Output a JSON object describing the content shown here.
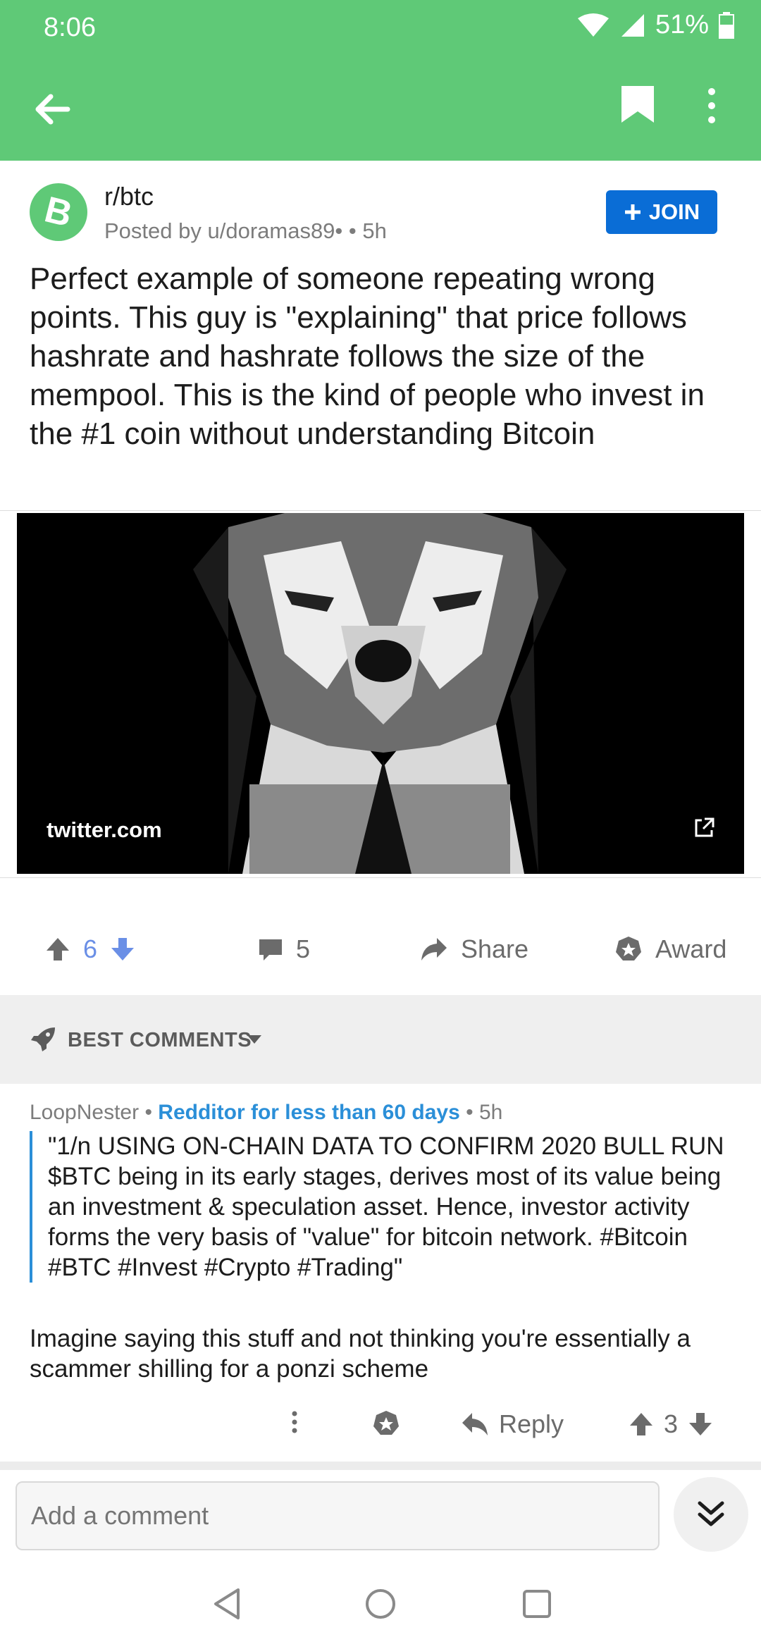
{
  "status": {
    "time": "8:06",
    "battery": "51%"
  },
  "post": {
    "subreddit": "r/btc",
    "subreddit_icon_letter": "B",
    "posted_by": "Posted by u/doramas89• • 5h",
    "join_label": "JOIN",
    "title": "Perfect example of someone repeating wrong points. This guy is \"explaining\" that price follows hashrate and hashrate follows the size of the mempool. This is the kind of people who invest in the #1 coin without understanding Bitcoin",
    "link_domain": "twitter.com",
    "score": "6",
    "comments_count": "5",
    "share_label": "Share",
    "award_label": "Award"
  },
  "sort": {
    "label": "BEST COMMENTS"
  },
  "comment": {
    "author": "LoopNester",
    "flair": "Redditor for less than 60 days",
    "time": "5h",
    "quote": "\"1/n USING ON-CHAIN DATA TO CONFIRM 2020 BULL RUN $BTC being in its early stages, derives most of its value being an investment & speculation asset. Hence, investor activity forms the very basis of \"value\" for bitcoin network. #Bitcoin #BTC #Invest #Crypto #Trading\"",
    "body": "Imagine saying this stuff and not thinking you're essentially a scammer shilling for a ponzi scheme",
    "reply_label": "Reply",
    "score": "3"
  },
  "composer": {
    "placeholder": "Add a comment"
  },
  "colors": {
    "header_green": "#5fc977",
    "join_blue": "#0a6dd6",
    "flair_blue": "#2b8fd8",
    "upvote_blue": "#6a8fe6"
  },
  "icons": [
    "back-arrow-icon",
    "bookmark-icon",
    "more-vert-icon",
    "bitcoin-icon",
    "plus-icon",
    "external-link-icon",
    "upvote-icon",
    "downvote-icon",
    "comment-icon",
    "share-icon",
    "award-icon",
    "rocket-icon",
    "caret-down-icon",
    "reply-icon",
    "chevron-double-down-icon"
  ]
}
